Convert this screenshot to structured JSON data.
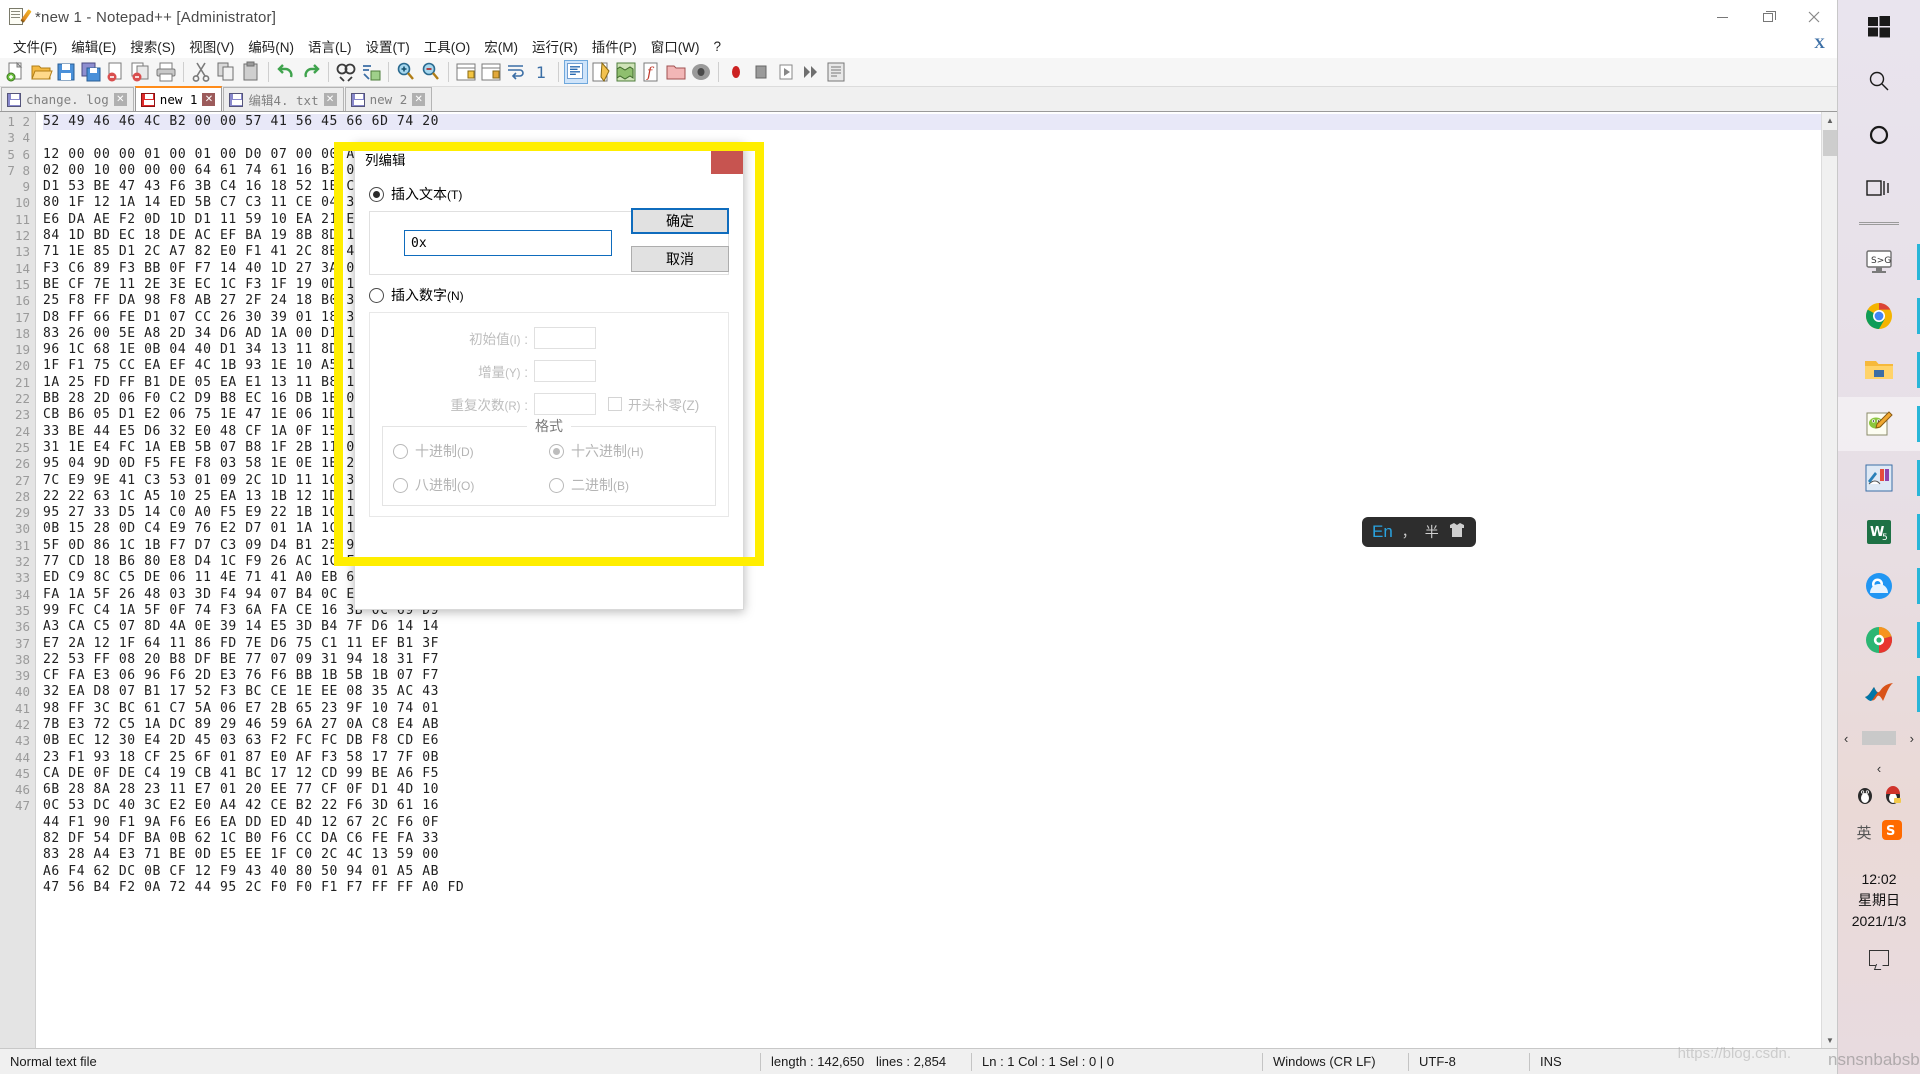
{
  "window": {
    "title": "*new 1 - Notepad++ [Administrator]",
    "icon": "notepad-plus-plus-icon",
    "controls": {
      "minimize": "—",
      "maximize": "❐",
      "close": "✕"
    }
  },
  "menu": {
    "items": [
      "文件(F)",
      "编辑(E)",
      "搜索(S)",
      "视图(V)",
      "编码(N)",
      "语言(L)",
      "设置(T)",
      "工具(O)",
      "宏(M)",
      "运行(R)",
      "插件(P)",
      "窗口(W)",
      "?"
    ],
    "close_document": "X"
  },
  "toolbar": {
    "buttons": [
      "new-file-icon",
      "open-file-icon",
      "save-icon",
      "save-all-icon",
      "close-file-icon",
      "close-all-icon",
      "print-icon",
      "cut-icon",
      "copy-icon",
      "paste-icon",
      "undo-icon",
      "redo-icon",
      "find-icon",
      "replace-icon",
      "zoom-in-icon",
      "zoom-out-icon",
      "sync-vertical-scroll-icon",
      "sync-horizontal-scroll-icon",
      "word-wrap-icon",
      "show-all-chars-icon",
      "show-indent-guide-icon",
      "user-defined-language-icon",
      "document-map-icon",
      "function-list-icon",
      "folder-as-workspace-icon",
      "monitoring-icon",
      "record-macro-icon",
      "stop-macro-icon",
      "play-macro-icon",
      "run-macro-multiple-icon",
      "run-icon"
    ]
  },
  "tabs": [
    {
      "label": "change. log",
      "active": false,
      "icon": "save-icon-blue"
    },
    {
      "label": "new 1",
      "active": true,
      "icon": "save-icon-red"
    },
    {
      "label": "编辑4. txt",
      "active": false,
      "icon": "save-icon-blue"
    },
    {
      "label": "new 2",
      "active": false,
      "icon": "save-icon-blue"
    }
  ],
  "editor": {
    "first_line_number": 1,
    "lines": [
      "52 49 46 46 4C B2 00 00 57 41 56 45 66 6D 74 20",
      "12 00 00 00 01 00 01 00 D0 07 00 00 A0 0F 00 00",
      "02 00 10 00 00 00 64 61 74 61 16 B2 00 00 99 B1",
      "D1 53 BE 47 43 F6 3B C4 16 18 52 1E CD 75 4C 41",
      "80 1F 12 1A 14 ED 5B C7 C3 11 CE 04 3F DB D4 EF",
      "E6 DA AE F2 0D 1D D1 11 59 10 EA 21 E9 9F 33 1F",
      "84 1D BD EC 18 DE AC EF BA 19 8B 8D 10 7D 21 6B",
      "71 1E 85 D1 2C A7 82 E0 F1 41 2C 8B 43 2E DF E9",
      "F3 C6 89 F3 BB 0F F7 14 40 1D 27 3A 0C 1B 9E 8C",
      "BE CF 7E 11 2E 3E EC 1C F3 1F 19 0D 18 8F CB 1D",
      "25 F8 FF DA 98 F8 AB 27 2F 24 18 B0 30 62 11 5D",
      "D8 FF 66 FE D1 07 CC 26 30 39 01 18 3A 1E 2D 5C",
      "83 26 00 5E A8 2D 34 D6 AD 1A 00 D1 1D 8B 2C 43",
      "96 1C 68 1E 0B 04 40 D1 34 13 11 8D 1C 18 F6 01",
      "1F F1 75 CC EA EF 4C 1B 93 1E 10 A5 18 F8 30 17",
      "1A 25 FD FF B1 DE 05 EA E1 13 11 B8 1C 2D 51 1B",
      "BB 28 2D 06 F0 C2 D9 B8 EC 16 DB 1B 02 1D 40 17",
      "CB B6 05 D1 E2 06 75 1E 47 1E 06 1D 1A 8B 2C 16",
      "33 BE 44 E5 D6 32 E0 48 CF 1A 0F 15 1B 1E 23 18",
      "31 1E E4 FC 1A EB 5B 07 B8 1F 2B 11 0D 1E 3A 1A",
      "95 04 9D 0D F5 FE F8 03 58 1E 0E 1B 2B 0D 1C 1D",
      "7C E9 9E 41 C3 53 01 09 2C 1D 11 1C 3A 1E 0C 1B",
      "22 22 63 1C A5 10 25 EA 13 1B 12 1D 1E 0C 11 1A",
      "95 27 33 D5 14 C0 A0 F5 E9 22 1B 1C 1F 1D 2A 1B",
      "0B 15 28 0D C4 E9 76 E2 D7 01 1A 1C 11 1E 0D 1C",
      "5F 0D 86 1C 1B F7 D7 C3 09 D4 B1 25 99 55 11 24",
      "77 CD 18 B6 80 E8 D4 1C F9 26 AC 1C F6 11 8A F5",
      "ED C9 8C C5 DE 06 11 4E 71 41 A0 EB 6F B5 6D D9",
      "FA 1A 5F 26 48 03 3D F4 94 07 B4 0C ED F0 83 E1",
      "99 FC C4 1A 5F 0F 74 F3 6A FA CE 16 3B 0C 69 D9",
      "A3 CA C5 07 8D 4A 0E 39 14 E5 3D B4 7F D6 14 14",
      "E7 2A 12 1F 64 11 86 FD 7E D6 75 C1 11 EF B1 3F",
      "22 53 FF 08 20 B8 DF BE 77 07 09 31 94 18 31 F7",
      "CF FA E3 06 96 F6 2D E3 76 F6 BB 1B 5B 1B 07 F7",
      "32 EA D8 07 B1 17 52 F3 BC CE 1E EE 08 35 AC 43",
      "98 FF 3C BC 61 C7 5A 06 E7 2B 65 23 9F 10 74 01",
      "7B E3 72 C5 1A DC 89 29 46 59 6A 27 0A C8 E4 AB",
      "0B EC 12 30 E4 2D 45 03 63 F2 FC FC DB F8 CD E6",
      "23 F1 93 18 CF 25 6F 01 87 E0 AF F3 58 17 7F 0B",
      "CA DE 0F DE C4 19 CB 41 BC 17 12 CD 99 BE A6 F5",
      "6B 28 8A 28 23 11 E7 01 20 EE 77 CF 0F D1 4D 10",
      "0C 53 DC 40 3C E2 E0 A4 42 CE B2 22 F6 3D 61 16",
      "44 F1 90 F1 9A F6 E6 EA DD ED 4D 12 67 2C F6 0F",
      "82 DF 54 DF BA 0B 62 1C B0 F6 CC DA C6 FE FA 33",
      "83 28 A4 E3 71 BE 0D E5 EE 1F C0 2C 4C 13 59 00",
      "A6 F4 62 DC 0B CF 12 F9 43 40 80 50 94 01 A5 AB",
      "47 56 B4 F2 0A 72 44 95 2C F0 F0 F1 F7 FF FF A0 FD"
    ],
    "scrollbar": {
      "up_arrow": "▲",
      "down_arrow": "▼"
    }
  },
  "status_bar": {
    "file_type": "Normal text file",
    "length": "length : 142,650",
    "lines": "lines : 2,854",
    "caret": "Ln : 1    Col : 1    Sel : 0 | 0",
    "eol": "Windows (CR LF)",
    "encoding": "UTF-8",
    "insert_mode": "INS"
  },
  "dialog": {
    "title": "列编辑",
    "close_label": "",
    "insert_text": {
      "radio_label": "插入文本",
      "accelerator": "(T)",
      "selected": true,
      "value": "0x",
      "placeholder": ""
    },
    "insert_number": {
      "radio_label": "插入数字",
      "accelerator": "(N)",
      "selected": false,
      "fields": [
        {
          "label": "初始值",
          "accelerator": "(I)",
          "suffix": " :",
          "value": ""
        },
        {
          "label": "增量",
          "accelerator": "(Y)",
          "suffix": " :",
          "value": ""
        },
        {
          "label": "重复次数",
          "accelerator": "(R)",
          "suffix": " :",
          "value": ""
        }
      ],
      "leading_zeros": {
        "label": "开头补零",
        "accelerator": "(Z)",
        "checked": false
      },
      "format": {
        "legend": "格式",
        "options": [
          {
            "label": "十进制",
            "accelerator": "(D)",
            "selected": false
          },
          {
            "label": "十六进制",
            "accelerator": "(H)",
            "selected": true
          },
          {
            "label": "八进制",
            "accelerator": "(O)",
            "selected": false
          },
          {
            "label": "二进制",
            "accelerator": "(B)",
            "selected": false
          }
        ]
      }
    },
    "buttons": {
      "ok": "确定",
      "cancel": "取消"
    }
  },
  "ime_bar": {
    "mode": "En",
    "punctuation": "，",
    "width_mode": "半",
    "skin": "skin-shirt-icon"
  },
  "taskbar": {
    "start": "windows-start-icon",
    "search": "search-icon",
    "cortana": "cortana-circle-icon",
    "task_view": "task-view-icon",
    "pinned": [
      "screen-to-gif-icon",
      "google-chrome-icon",
      "file-explorer-icon",
      "notepad-plus-plus-icon",
      "editor-app-icon",
      "wps-spreadsheet-icon",
      "qq-browser-icon",
      "360-browser-icon",
      "matlab-icon"
    ],
    "tray": {
      "chevron": "‹",
      "icons": [
        "qq-penguin-icon",
        "qq-penguin-badge-icon",
        "ime-english-icon",
        "sogou-ime-icon"
      ],
      "time": "12:02",
      "weekday": "星期日",
      "date": "2021/1/3",
      "notifications": "notification-icon"
    },
    "scroll_left": "‹",
    "scroll_right": "›"
  },
  "watermarks": {
    "status": "https://blog.csdn.",
    "taskbar": "nsnsnbabsb"
  },
  "colors": {
    "accent_blue": "#0f6cbd",
    "highlight_yellow": "#ffee00",
    "dialog_close_red": "#c75450",
    "active_tab_orange": "#ff8c1a",
    "selected_line": "#e8e8f8"
  }
}
